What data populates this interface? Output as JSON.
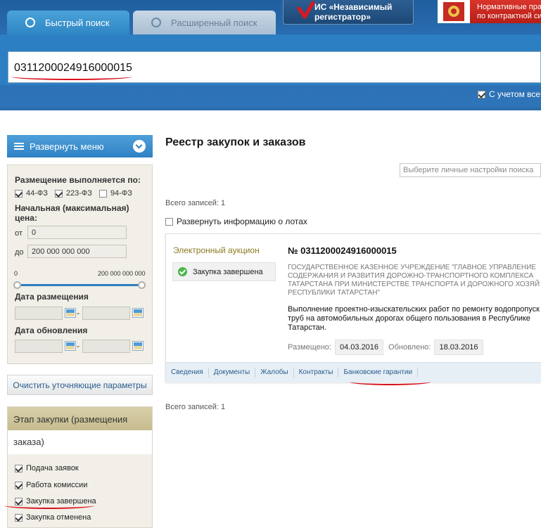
{
  "tabs": {
    "quick": "Быстрый поиск",
    "advanced": "Расширенный поиск"
  },
  "banner": {
    "registrar_line1": "ИС «Независимый",
    "registrar_line2": "регистратор»",
    "npa_line1": "Нормативные пра",
    "npa_line2": "по контрактной си"
  },
  "search": {
    "value": "0311200024916000015",
    "consider_label": "С учетом все"
  },
  "sidebar": {
    "expand_menu": "Развернуть меню",
    "placement_label": "Размещение выполняется по:",
    "laws": [
      {
        "label": "44-ФЗ",
        "checked": true
      },
      {
        "label": "223-ФЗ",
        "checked": true
      },
      {
        "label": "94-ФЗ",
        "checked": false
      }
    ],
    "price_label_1": "Начальная (максимальная)",
    "price_label_2": "цена:",
    "from_label": "от",
    "from_value": "0",
    "to_label": "до",
    "to_value": "200 000 000 000",
    "range_min": "0",
    "range_max": "200 000 000 000",
    "slider_low_fraction": 0,
    "slider_high_fraction": 1,
    "placement_date_label": "Дата размещения",
    "update_date_label": "Дата обновления",
    "dash": "-",
    "clear_button": "Очистить уточняющие параметры",
    "stage_title": "Этап закупки (размещения",
    "stage_title_cont": "заказа)",
    "stages": [
      {
        "label": "Подача заявок",
        "checked": true
      },
      {
        "label": "Работа комиссии",
        "checked": true
      },
      {
        "label": "Закупка завершена",
        "checked": true
      },
      {
        "label": "Закупка отменена",
        "checked": true
      }
    ]
  },
  "main": {
    "title": "Реестр закупок и заказов",
    "settings_placeholder": "Выберите личные настройки поиска",
    "total_records": "Всего записей: 1",
    "expand_lots": "Развернуть информацию о лотах"
  },
  "card": {
    "type": "Электронный аукцион",
    "status": "Закупка завершена",
    "number": "№ 0311200024916000015",
    "customer_lines": [
      "ГОСУДАРСТВЕННОЕ КАЗЕННОЕ УЧРЕЖДЕНИЕ \"ГЛАВНОЕ УПРАВЛЕНИЕ",
      "СОДЕРЖАНИЯ И РАЗВИТИЯ ДОРОЖНО-ТРАНСПОРТНОГО КОМПЛЕКСА",
      "ТАТАРСТАНА ПРИ МИНИСТЕРСТВЕ ТРАНСПОРТА И ДОРОЖНОГО ХОЗЯЙ",
      "РЕСПУБЛИКИ ТАТАРСТАН\""
    ],
    "subject_lines": [
      "Выполнение проектно-изыскательских работ по ремонту водопропуск",
      "труб на автомобильных дорогах общего пользования в Республике",
      "Татарстан."
    ],
    "placed_label": "Размещено:",
    "placed_date": "04.03.2016",
    "updated_label": "Обновлено:",
    "updated_date": "18.03.2016",
    "tabs": [
      "Сведения",
      "Документы",
      "Жалобы",
      "Контракты",
      "Банковские гарантии"
    ]
  }
}
